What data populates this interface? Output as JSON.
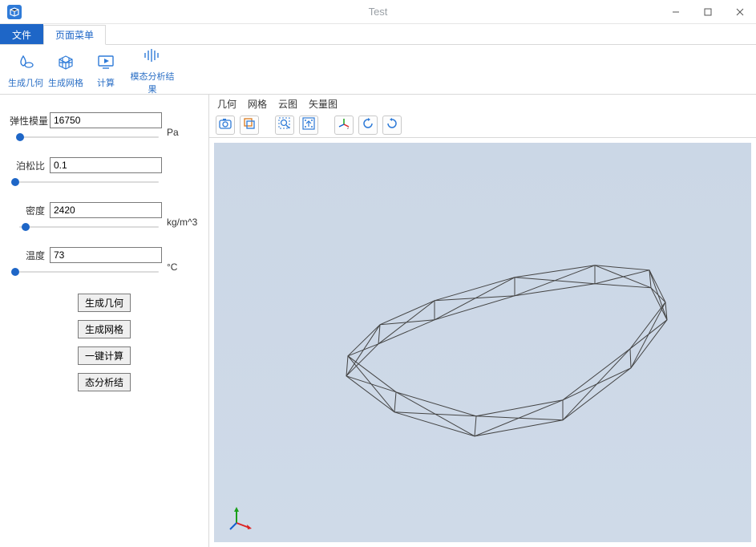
{
  "window": {
    "title": "Test"
  },
  "tabs": {
    "file": "文件",
    "page_menu": "页面菜单"
  },
  "ribbon": {
    "gen_geom": "生成几何",
    "gen_mesh": "生成网格",
    "compute": "计算",
    "modal_results": "模态分析结果"
  },
  "sidebar": {
    "elastic_modulus": {
      "label": "弹性模量",
      "value": "16750",
      "unit": "Pa",
      "slider_pct": 3
    },
    "poisson": {
      "label": "泊松比",
      "value": "0.1",
      "unit": "",
      "slider_pct": 0
    },
    "density": {
      "label": "密度",
      "value": "2420",
      "unit": "kg/m^3",
      "slider_pct": 7
    },
    "temperature": {
      "label": "温度",
      "value": "73",
      "unit": "°C",
      "slider_pct": 0
    },
    "buttons": {
      "gen_geom": "生成几何",
      "gen_mesh": "生成网格",
      "one_click": "一键计算",
      "analysis": "态分析结"
    }
  },
  "viewer": {
    "tabs": {
      "geom": "几何",
      "mesh": "网格",
      "cloud": "云图",
      "vector": "矢量图"
    }
  }
}
